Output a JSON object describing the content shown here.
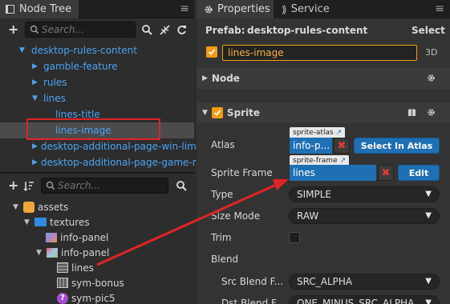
{
  "node_tree": {
    "tab_label": "Node Tree",
    "close_glyph": "≡",
    "search_placeholder": "Search...",
    "items": [
      {
        "label": "desktop-rules-content",
        "arrow": "▼"
      },
      {
        "label": "gamble-feature",
        "arrow": "▶"
      },
      {
        "label": "rules",
        "arrow": "▶"
      },
      {
        "label": "lines",
        "arrow": "▼"
      },
      {
        "label": "lines-title",
        "arrow": ""
      },
      {
        "label": "lines-image",
        "arrow": ""
      },
      {
        "label": "desktop-additional-page-win-limit",
        "arrow": "▶"
      },
      {
        "label": "desktop-additional-page-game-resu",
        "arrow": "▶"
      }
    ]
  },
  "assets": {
    "search_placeholder": "Search...",
    "items": [
      {
        "label": "assets",
        "arrow": "▼",
        "icon": "assets-db-icon"
      },
      {
        "label": "textures",
        "arrow": "▼",
        "icon": "folder-icon"
      },
      {
        "label": "info-panel",
        "arrow": "",
        "icon": "texture-icon"
      },
      {
        "label": "info-panel",
        "arrow": "▼",
        "icon": "texture-icon"
      },
      {
        "label": "lines",
        "arrow": "",
        "icon": "sprite-frame-icon"
      },
      {
        "label": "sym-bonus",
        "arrow": "",
        "icon": "sprite-frame-icon"
      },
      {
        "label": "sym-pic5",
        "arrow": "",
        "icon": "unknown-asset-icon"
      }
    ]
  },
  "properties": {
    "tab_label": "Properties",
    "service_tab_label": "Service",
    "close_glyph": "≡",
    "prefab_label": "Prefab:",
    "prefab_name": "desktop-rules-content",
    "select_label": "Select",
    "node_name": "lines-image",
    "mode_3d": "3D",
    "node_section": "Node",
    "sprite_section": "Sprite",
    "atlas": {
      "label": "Atlas",
      "tag": "sprite-atlas",
      "value": "info-p...",
      "button": "Select In Atlas"
    },
    "sprite_frame": {
      "label": "Sprite Frame",
      "tag": "sprite-frame",
      "value": "lines",
      "button": "Edit"
    },
    "type": {
      "label": "Type",
      "value": "SIMPLE"
    },
    "size_mode": {
      "label": "Size Mode",
      "value": "RAW"
    },
    "trim": {
      "label": "Trim"
    },
    "blend": {
      "label": "Blend"
    },
    "src_blend": {
      "label": "Src Blend F...",
      "value": "SRC_ALPHA"
    },
    "dst_blend": {
      "label": "Dst Blend F...",
      "value": "ONE_MINUS_SRC_ALPHA"
    }
  },
  "colors": {
    "accent_blue": "#1f6fb4",
    "node_blue": "#4aa3f2",
    "highlight_red": "#e02424",
    "check_orange": "#f39c12"
  }
}
